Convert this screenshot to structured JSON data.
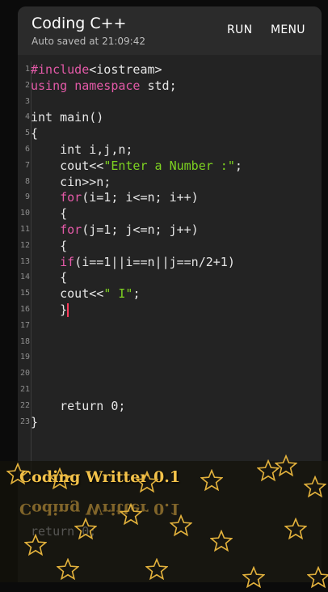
{
  "app": {
    "title": "Coding C++",
    "autosave": "Auto saved at 21:09:42",
    "run_label": "RUN",
    "menu_label": "MENU"
  },
  "editor": {
    "lines": [
      {
        "n": "1",
        "text": "#include<iostream>"
      },
      {
        "n": "2",
        "text": "using namespace std;"
      },
      {
        "n": "3",
        "text": ""
      },
      {
        "n": "4",
        "text": "int main()"
      },
      {
        "n": "5",
        "text": "{"
      },
      {
        "n": "6",
        "text": "    int i,j,n;"
      },
      {
        "n": "7",
        "text": "    cout<<\"Enter a Number :\";"
      },
      {
        "n": "8",
        "text": "    cin>>n;"
      },
      {
        "n": "9",
        "text": "    for(i=1; i<=n; i++)"
      },
      {
        "n": "10",
        "text": "    {"
      },
      {
        "n": "11",
        "text": "    for(j=1; j<=n; j++)"
      },
      {
        "n": "12",
        "text": "    {"
      },
      {
        "n": "13",
        "text": "    if(i==1||i==n||j==n/2+1)"
      },
      {
        "n": "14",
        "text": "    {"
      },
      {
        "n": "15",
        "text": "    cout<<\" I\";"
      },
      {
        "n": "16",
        "text": "    }"
      },
      {
        "n": "17",
        "text": ""
      },
      {
        "n": "18",
        "text": ""
      },
      {
        "n": "19",
        "text": ""
      },
      {
        "n": "20",
        "text": ""
      },
      {
        "n": "21",
        "text": ""
      },
      {
        "n": "22",
        "text": "    return 0;"
      },
      {
        "n": "23",
        "text": "}"
      }
    ],
    "cursor_line": "16"
  },
  "overlay": {
    "banner_text": "Coding Writter 0.1",
    "mirror_code": "return 0;"
  },
  "colors": {
    "keyword": "#e45aa8",
    "string": "#7ed321",
    "banner": "#f3c24a",
    "cursor": "#ff3b5c"
  }
}
